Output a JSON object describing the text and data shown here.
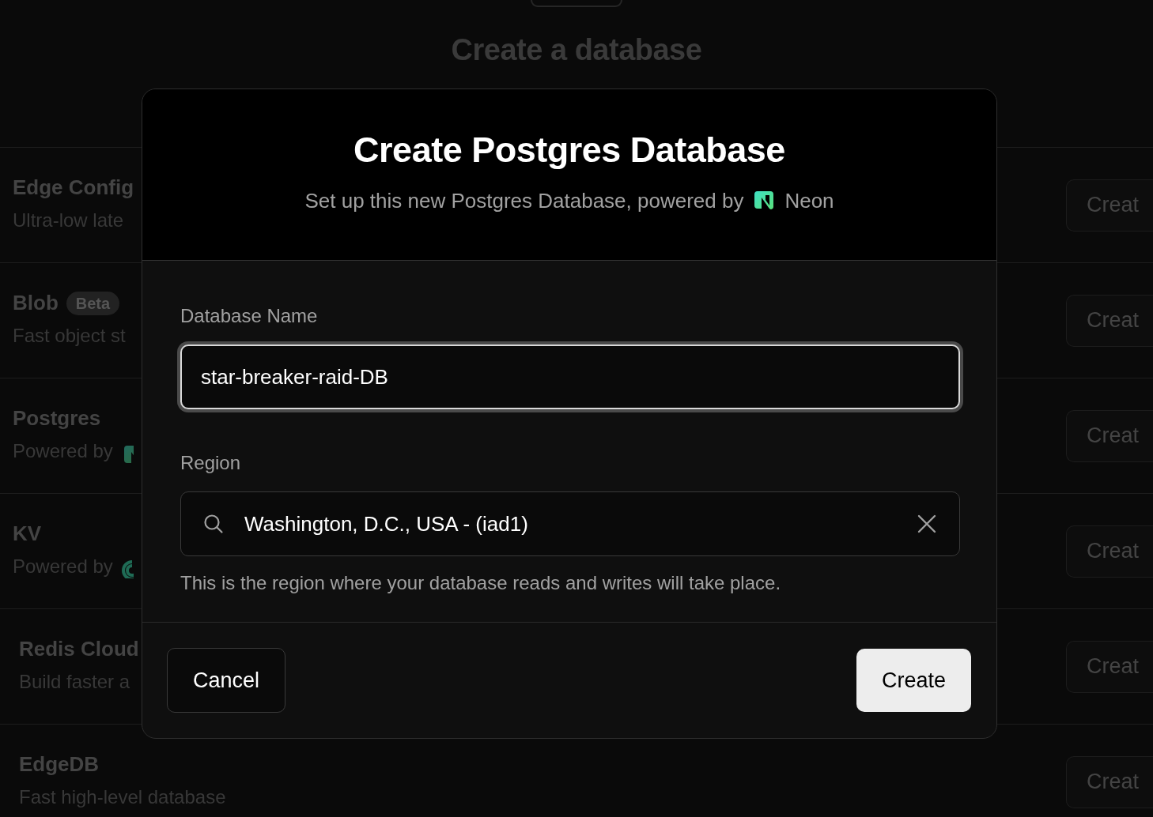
{
  "page": {
    "title": "Create a database"
  },
  "integrations": [
    {
      "kind": "native",
      "name": "Edge Config",
      "description": "Ultra-low late",
      "action": "Creat"
    },
    {
      "kind": "native",
      "name": "Blob",
      "badge": "Beta",
      "description": "Fast object st",
      "action": "Creat"
    },
    {
      "kind": "neon",
      "name": "Postgres",
      "description": "Powered by",
      "action": "Creat"
    },
    {
      "kind": "upstash",
      "name": "KV",
      "description": "Powered by",
      "action": "Creat"
    },
    {
      "kind": "external",
      "name": "Redis Cloud",
      "description": "Build faster a",
      "action": "Creat"
    },
    {
      "kind": "external",
      "name": "EdgeDB",
      "description": "Fast high-level database",
      "action": "Creat"
    }
  ],
  "modal": {
    "title": "Create Postgres Database",
    "subtitle": "Set up this new Postgres Database, powered by",
    "provider": "Neon",
    "name_field": {
      "label": "Database Name",
      "value": "star-breaker-raid-DB",
      "focused": true
    },
    "region_field": {
      "label": "Region",
      "value": "Washington, D.C., USA - (iad1)",
      "help": "This is the region where your database reads and writes will take place."
    },
    "buttons": [
      {
        "kind": "secondary",
        "label": "Cancel"
      },
      {
        "kind": "primary",
        "label": "Create"
      }
    ]
  }
}
